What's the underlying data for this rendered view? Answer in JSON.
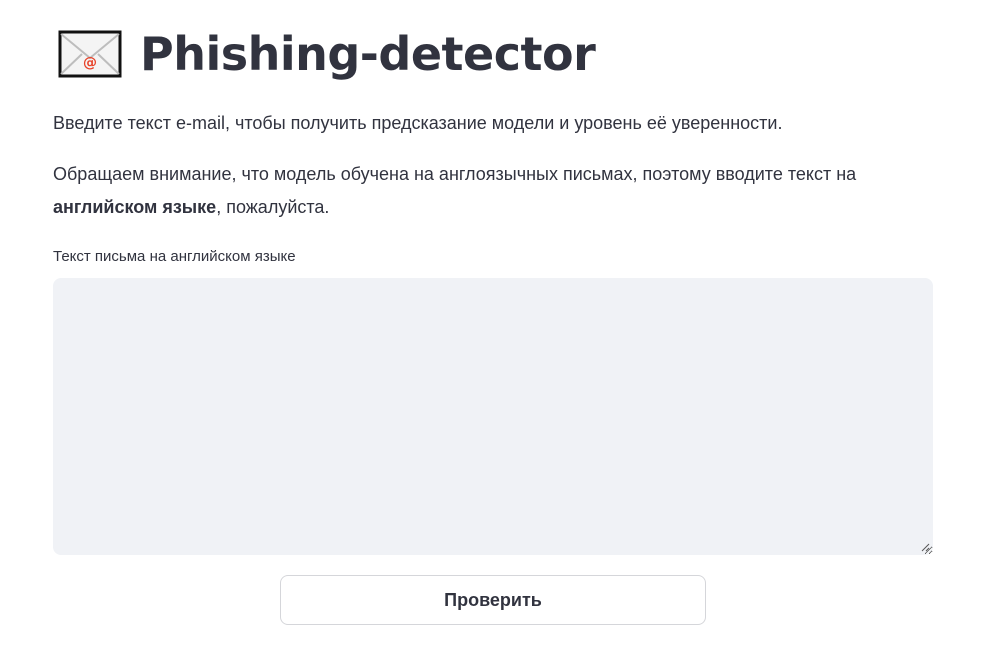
{
  "header": {
    "icon": "envelope-icon",
    "title": "Phishing-detector"
  },
  "intro": {
    "line1": "Введите текст e-mail, чтобы получить предсказание модели и уровень её уверенности.",
    "line2_before": "Обращаем внимание, что модель обучена на англоязычных письмах, поэтому вводите текст на ",
    "line2_bold": "английском языке",
    "line2_after": ", пожалуйста."
  },
  "form": {
    "label": "Текст письма на английском языке",
    "value": "",
    "button_label": "Проверить"
  },
  "colors": {
    "text": "#31333f",
    "input_bg": "#f0f2f6",
    "envelope_at": "#e8432a"
  }
}
